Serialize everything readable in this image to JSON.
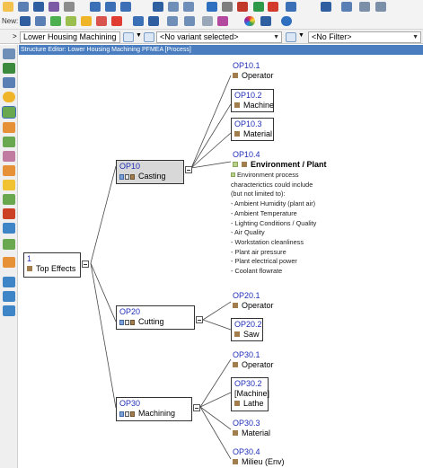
{
  "toolbar": {
    "new_label": "New:"
  },
  "selectors": {
    "structure": "Lower Housing Machining",
    "variant": "<No variant selected>",
    "filter": "<No Filter>",
    "structure_prefix": ">"
  },
  "editor_title": "Structure Editor: Lower Housing Machining PFMEA [Process]",
  "root": {
    "id": "1",
    "name": "Top Effects"
  },
  "ops": [
    {
      "id": "OP10",
      "name": "Casting"
    },
    {
      "id": "OP20",
      "name": "Cutting"
    },
    {
      "id": "OP30",
      "name": "Machining"
    }
  ],
  "leaves": {
    "op10_1": {
      "id": "OP10.1",
      "name": "Operator"
    },
    "op10_2": {
      "id": "OP10.2",
      "name": "Machine"
    },
    "op10_3": {
      "id": "OP10.3",
      "name": "Material"
    },
    "op10_4": {
      "id": "OP10.4",
      "name": "Environment / Plant"
    },
    "op20_1": {
      "id": "OP20.1",
      "name": "Operator"
    },
    "op20_2": {
      "id": "OP20.2",
      "name": "Saw"
    },
    "op30_1": {
      "id": "OP30.1",
      "name": "Operator"
    },
    "op30_2": {
      "id": "OP30.2",
      "name1": "[Machine]",
      "name2": "Lathe"
    },
    "op30_3": {
      "id": "OP30.3",
      "name": "Material"
    },
    "op30_4": {
      "id": "OP30.4",
      "name": "Milieu (Env)"
    }
  },
  "env_description": [
    "Environment process",
    "characterictics could include",
    "(but not limited to):",
    " - Ambient Humidity (plant air)",
    " - Ambient Temperature",
    " - Lighting Conditions / Quality",
    " - Air Quality",
    " - Workstation cleanliness",
    " - Plant air pressure",
    " - Plant electrical power",
    " - Coolant flowrate"
  ],
  "icons": [
    "print-icon",
    "save-icon",
    "cut-icon",
    "copy-icon",
    "paste-icon",
    "undo-icon",
    "redo-icon",
    "find-icon",
    "filter-icon",
    "delete-icon",
    "color-wheel-icon",
    "help-icon"
  ]
}
